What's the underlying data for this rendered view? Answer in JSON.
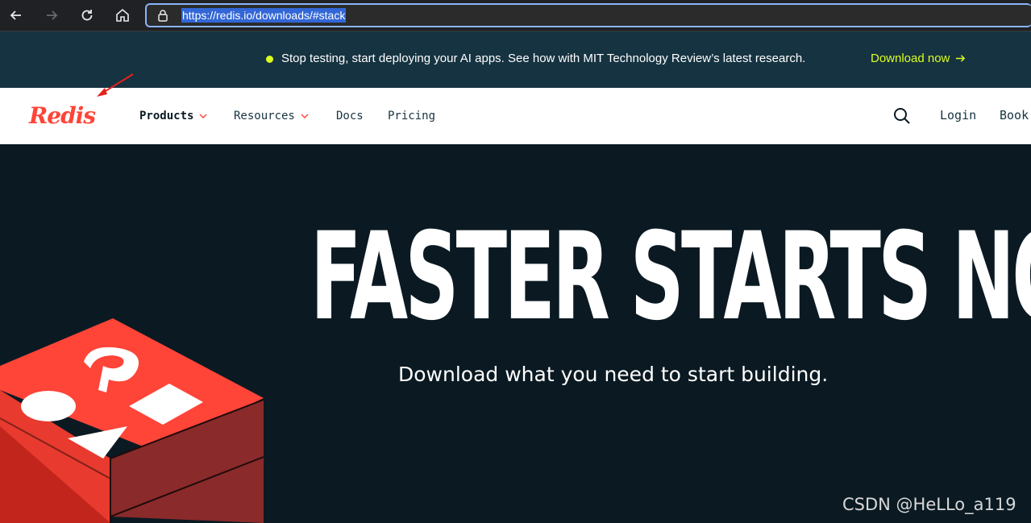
{
  "browser": {
    "url": "https://redis.io/downloads/#stack"
  },
  "banner": {
    "text": "Stop testing, start deploying your AI apps. See how with MIT Technology Review’s latest research.",
    "link_label": "Download now",
    "accent_color": "#dcff1e"
  },
  "header": {
    "logo": "Redis",
    "nav": [
      {
        "label": "Products",
        "has_dropdown": true
      },
      {
        "label": "Resources",
        "has_dropdown": true
      },
      {
        "label": "Docs",
        "has_dropdown": false
      },
      {
        "label": "Pricing",
        "has_dropdown": false
      }
    ],
    "login_label": "Login",
    "book_label": "Book"
  },
  "hero": {
    "title": "FASTER STARTS NOW",
    "subtitle": "Download what you need to start building.",
    "brand_color": "#ff4438"
  },
  "watermark": "CSDN @HeLLo_a119"
}
